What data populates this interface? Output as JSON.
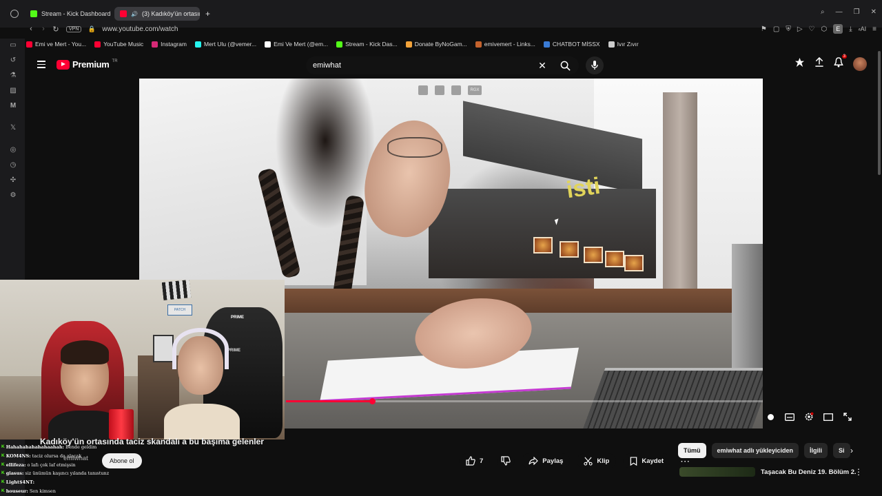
{
  "browser": {
    "tabs": [
      {
        "title": "Stream - Kick Dashboard",
        "active": false
      },
      {
        "title": "(3) Kadıköy'ün ortasın",
        "active": true
      }
    ],
    "new_tab": "+",
    "url": "www.youtube.com/watch",
    "vpn_label": "VPN",
    "ai_label": "AI",
    "profile_letter": "E"
  },
  "bookmarks": [
    {
      "label": "Emi ve Mert - You...",
      "color": "#ff0033"
    },
    {
      "label": "YouTube Music",
      "color": "#ff0033"
    },
    {
      "label": "Instagram",
      "color": "#d62976"
    },
    {
      "label": "Mert Ulu (@vemer...",
      "color": "#25f4ee"
    },
    {
      "label": "Emi Ve Mert (@em...",
      "color": "#ffffff"
    },
    {
      "label": "Stream - Kick Das...",
      "color": "#53fc18"
    },
    {
      "label": "Donate ByNoGam...",
      "color": "#f2a33a"
    },
    {
      "label": "emivemert - Links...",
      "color": "#c4622d"
    },
    {
      "label": "CHATBOT MİSSX",
      "color": "#3a7bd5"
    },
    {
      "label": "Ivır Zıvır",
      "color": "#cccccc"
    }
  ],
  "youtube": {
    "logo_text": "Premium",
    "logo_region": "TR",
    "search_query": "emiwhat",
    "notification_count": "3"
  },
  "video": {
    "title": "Kadıköy'ün ortasında taciz skandalı a bu başıma gelenler",
    "sign_text": "isti",
    "progress_fraction": 0.18,
    "overlay_buttons": [
      "",
      "",
      "",
      "RGX"
    ]
  },
  "channel": {
    "name": "emiwhat",
    "subscribe_label": "Abone ol"
  },
  "actions": {
    "like_count": "7",
    "share_label": "Paylaş",
    "clip_label": "Klip",
    "save_label": "Kaydet"
  },
  "chips": [
    "Tümü",
    "emiwhat adlı yükleyiciden",
    "İlgili",
    "Si"
  ],
  "recommendation": {
    "title": "Taşacak Bu Deniz 19. Bölüm 2."
  },
  "chat": [
    {
      "user": "Hahahahahahahaahah:",
      "msg": "Bende geldim"
    },
    {
      "user": "KOM4NS:",
      "msg": "taciz olursa da alacak"
    },
    {
      "user": "ellifeza:",
      "msg": "o lafı çok laf etmişsin"
    },
    {
      "user": "giasus:",
      "msg": "siz ünümün kaşıncı yılanda tanıstunz"
    },
    {
      "user": "Light$4NT:",
      "msg": ""
    },
    {
      "user": "houseur:",
      "msg": "Sen kimsen"
    }
  ],
  "webcam": {
    "sign_text": "PATCH",
    "chair_brand": "PRIME"
  },
  "colors": {
    "accent": "#ff0033",
    "kick_green": "#53fc18",
    "background": "#0f0f0f"
  }
}
